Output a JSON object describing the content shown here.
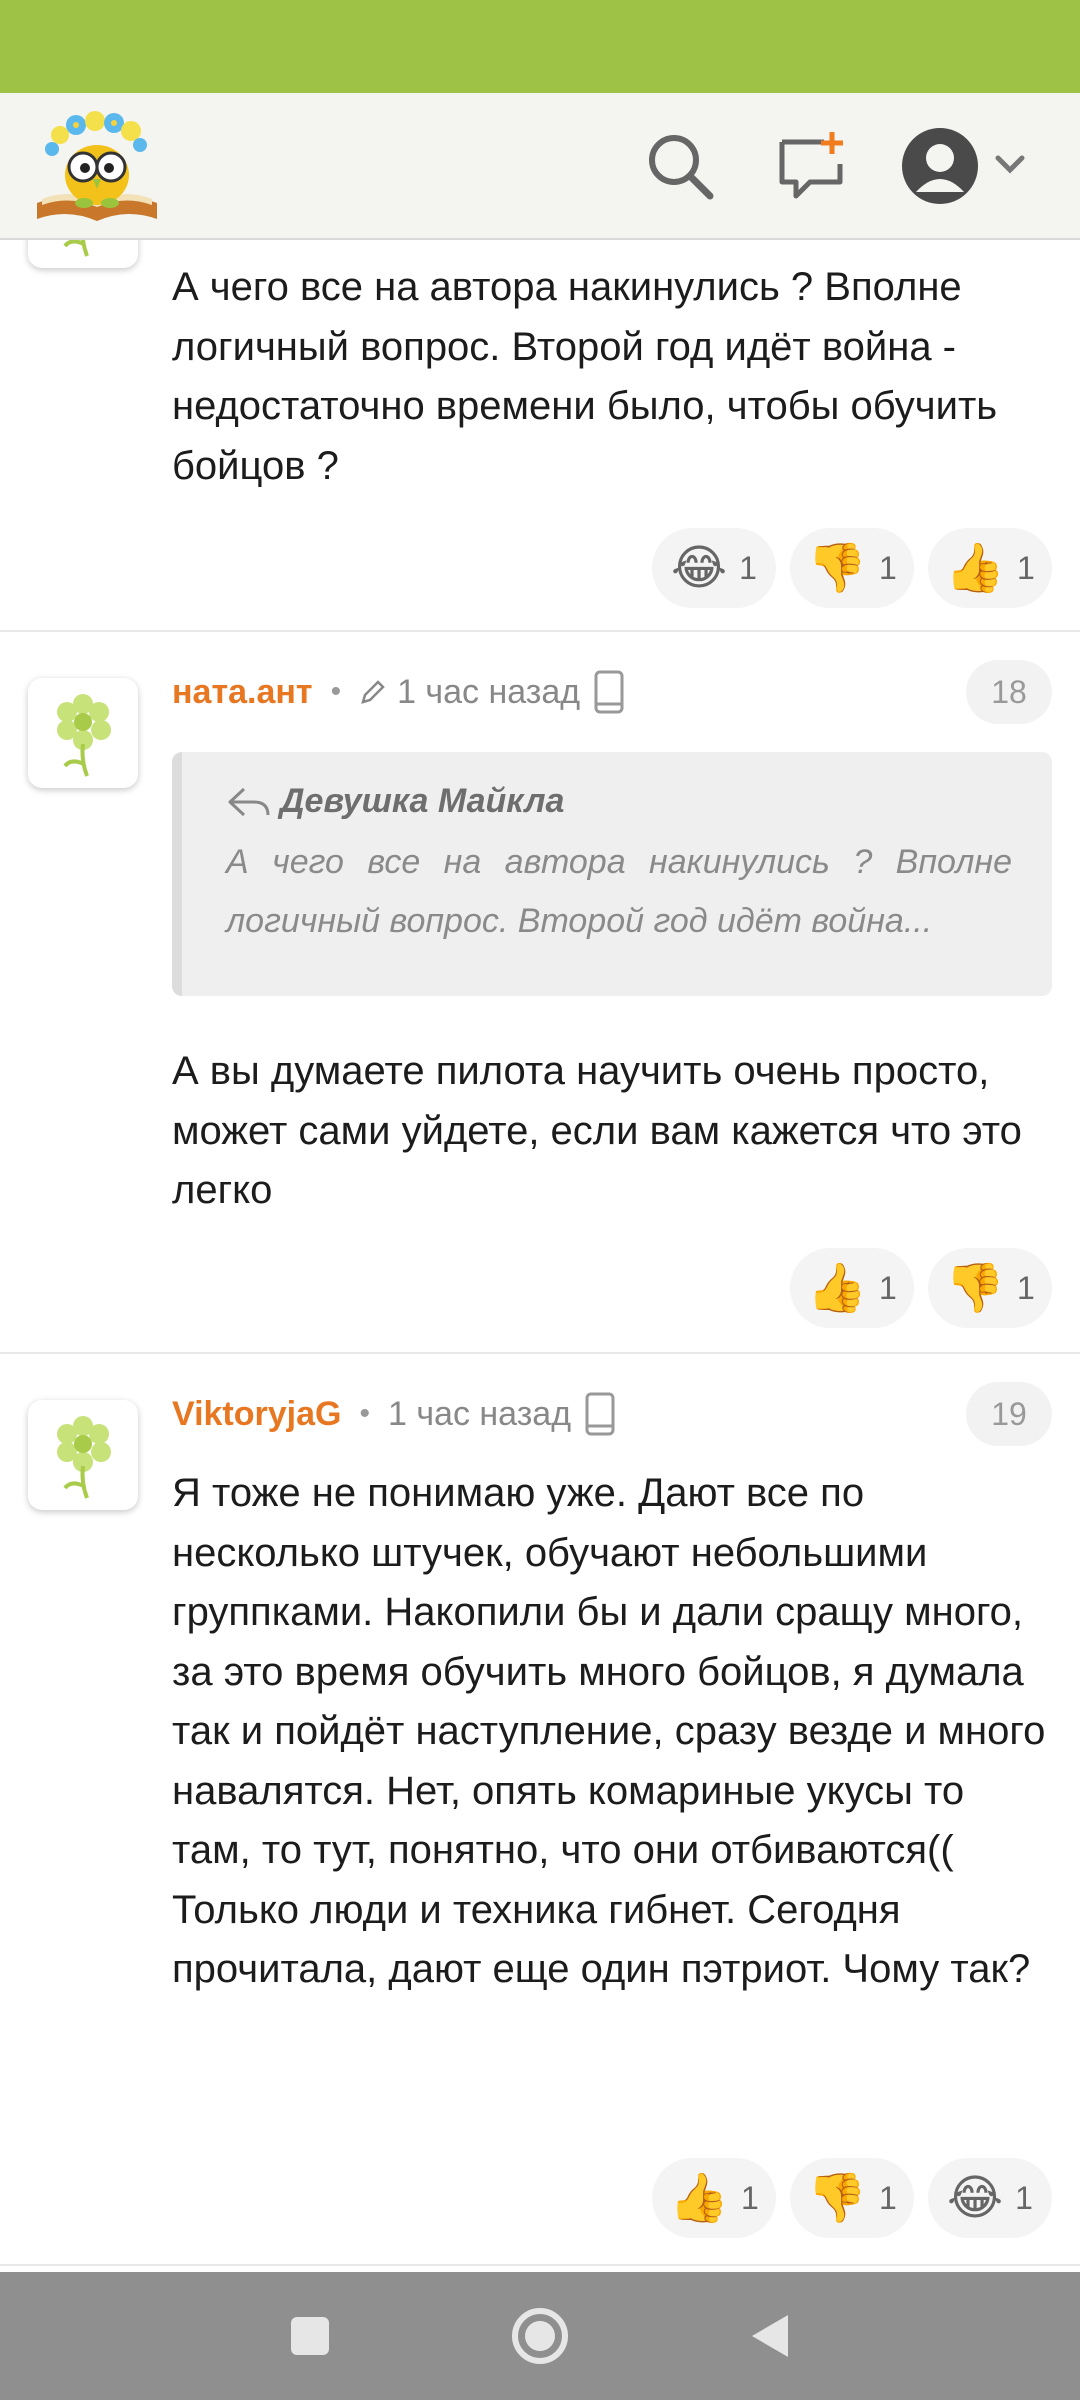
{
  "header": {
    "logo_icon": "owl-on-book-logo",
    "search_icon": "search-icon",
    "new_post_icon": "add-comment-icon",
    "profile_icon": "user-avatar-icon"
  },
  "comments": [
    {
      "text": "А чего все на автора накинулись ? Вполне логичный вопрос. Второй год идёт война - недостаточно времени было, чтобы обучить бойцов ?",
      "reactions": [
        {
          "emoji": "😂",
          "count": "1"
        },
        {
          "emoji": "👎",
          "count": "1"
        },
        {
          "emoji": "👍",
          "count": "1"
        }
      ]
    },
    {
      "author": "ната.ант",
      "edited_icon": "pencil-icon",
      "time": "1 час назад",
      "device_icon": "phone-icon",
      "number": "18",
      "quote": {
        "author": "Девушка Майкла",
        "text": "А чего все на автора накинулись ? Вполне логичный вопрос. Второй год идёт война..."
      },
      "text": "А вы думаете пилота научить очень просто, может сами уйдете, если вам кажется что это легко",
      "reactions": [
        {
          "emoji": "👍",
          "count": "1"
        },
        {
          "emoji": "👎",
          "count": "1"
        }
      ]
    },
    {
      "author": "ViktoryjaG",
      "time": "1 час назад",
      "device_icon": "phone-icon",
      "number": "19",
      "text": "Я тоже не понимаю уже. Дают все по несколько штучек, обучают небольшими группками. Накопили бы и дали сращу много, за это время обучить много бойцов, я думала так и пойдёт наступление, сразу везде и много навалятся. Нет, опять комариные укусы то там, то тут, понятно, что они отбиваются(( Только люди и техника гибнет. Сегодня прочитала, дают еще один пэтриот. Чому так?",
      "reactions": [
        {
          "emoji": "👍",
          "count": "1"
        },
        {
          "emoji": "👎",
          "count": "1"
        },
        {
          "emoji": "😂",
          "count": "1"
        }
      ]
    }
  ],
  "navbar": {
    "recents_icon": "square-icon",
    "home_icon": "circle-icon",
    "back_icon": "triangle-back-icon"
  }
}
